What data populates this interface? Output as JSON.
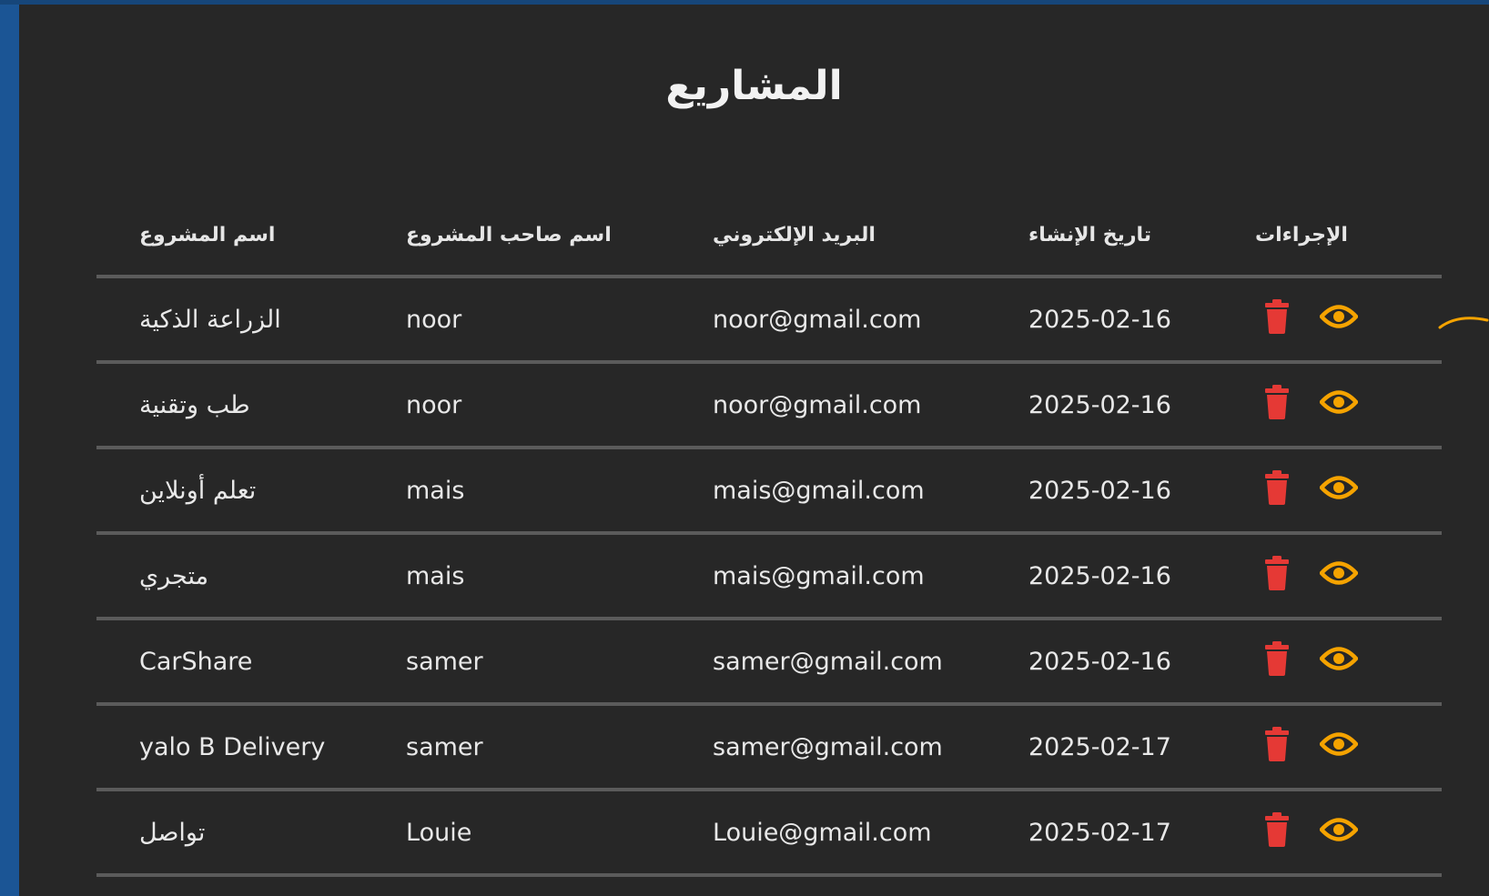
{
  "page": {
    "title": "المشاريع"
  },
  "colors": {
    "frame_blue": "#1b5595",
    "panel_bg": "#272727",
    "divider": "#5b5b5b",
    "delete_red": "#e53935",
    "view_orange": "#f5a300"
  },
  "table": {
    "columns": {
      "name": "اسم المشروع",
      "owner": "اسم صاحب المشروع",
      "email": "البريد الإلكتروني",
      "created": "تاريخ الإنشاء",
      "actions": "الإجراءات"
    },
    "row_icons": {
      "delete": "trash-icon",
      "view": "eye-icon"
    },
    "rows": [
      {
        "name": "الزراعة الذكية",
        "owner": "noor",
        "email": "noor@gmail.com",
        "created": "2025-02-16"
      },
      {
        "name": "طب وتقنية",
        "owner": "noor",
        "email": "noor@gmail.com",
        "created": "2025-02-16"
      },
      {
        "name": "تعلم أونلاين",
        "owner": "mais",
        "email": "mais@gmail.com",
        "created": "2025-02-16"
      },
      {
        "name": "متجري",
        "owner": "mais",
        "email": "mais@gmail.com",
        "created": "2025-02-16"
      },
      {
        "name": "CarShare",
        "owner": "samer",
        "email": "samer@gmail.com",
        "created": "2025-02-16"
      },
      {
        "name": "yalo B Delivery",
        "owner": "samer",
        "email": "samer@gmail.com",
        "created": "2025-02-17"
      },
      {
        "name": "تواصل",
        "owner": "Louie",
        "email": "Louie@gmail.com",
        "created": "2025-02-17"
      }
    ]
  }
}
